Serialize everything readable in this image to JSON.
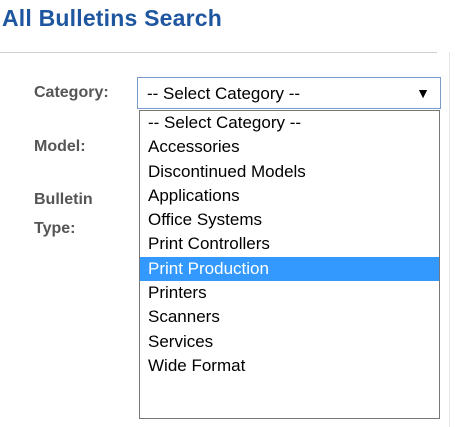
{
  "page": {
    "title": "All Bulletins Search"
  },
  "form": {
    "category_label": "Category:",
    "model_label": "Model:",
    "bulletin_label": "Bulletin",
    "type_label": "Type:"
  },
  "category_select": {
    "selected_value": "-- Select Category --",
    "highlighted_option": "Print Production",
    "options": [
      "-- Select Category --",
      "Accessories",
      "Discontinued Models",
      "Applications",
      "Office Systems",
      "Print Controllers",
      "Print Production",
      "Printers",
      "Scanners",
      "Services",
      "Wide Format"
    ]
  },
  "icons": {
    "select_arrow": "chevron-down-icon"
  },
  "colors": {
    "title": "#1f56a0",
    "label": "#555555",
    "highlight": "#3399ff",
    "select_border": "#7a9cc8"
  }
}
